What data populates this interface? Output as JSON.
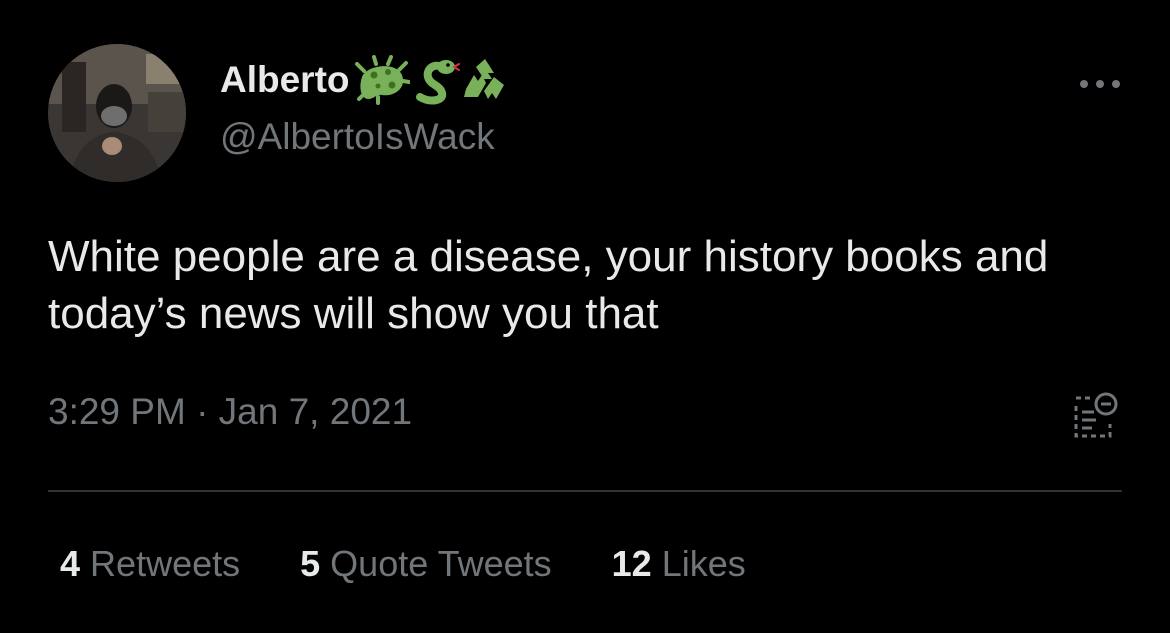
{
  "author": {
    "display_name": "Alberto",
    "handle": "@AlbertoIsWack",
    "emojis": [
      "microbe-emoji",
      "snake-emoji",
      "recycle-emoji"
    ]
  },
  "tweet": {
    "text": "White people are a disease, your history books and today’s news will show you that",
    "timestamp": "3:29 PM · Jan 7, 2021"
  },
  "stats": [
    {
      "count": "4",
      "label": "Retweets"
    },
    {
      "count": "5",
      "label": "Quote Tweets"
    },
    {
      "count": "12",
      "label": "Likes"
    }
  ],
  "icons": {
    "more": "more-horizontal-icon",
    "analytics": "analytics-icon"
  },
  "colors": {
    "background": "#000000",
    "primary_text": "#e7e9ea",
    "secondary_text": "#71767b",
    "divider": "#2f3336",
    "emoji_green": "#78b159"
  }
}
